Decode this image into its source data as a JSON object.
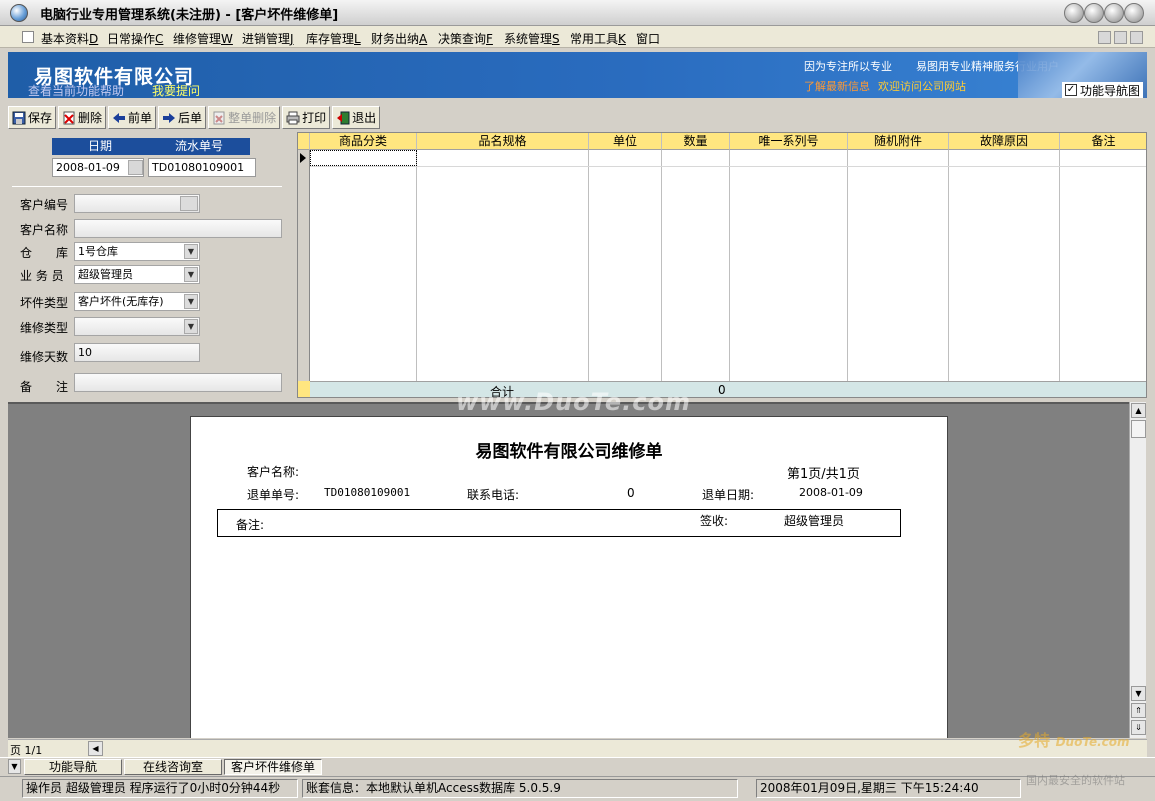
{
  "window": {
    "title": "电脑行业专用管理系统(未注册) - [客户坏件维修单]"
  },
  "menu": [
    {
      "label": "基本资料",
      "key": "D"
    },
    {
      "label": "日常操作",
      "key": "C"
    },
    {
      "label": "维修管理",
      "key": "W"
    },
    {
      "label": "进销管理",
      "key": "J"
    },
    {
      "label": "库存管理",
      "key": "L"
    },
    {
      "label": "财务出纳",
      "key": "A"
    },
    {
      "label": "决策查询",
      "key": "F"
    },
    {
      "label": "系统管理",
      "key": "S"
    },
    {
      "label": "常用工具",
      "key": "K"
    },
    {
      "label": "窗口",
      "key": ""
    }
  ],
  "banner": {
    "company": "易图软件有限公司",
    "help": "查看当前功能帮助",
    "ask": "我要提问",
    "slogan1": "因为专注所以专业",
    "slogan2": "易图用专业精神服务行业用户",
    "news": "了解最新信息",
    "visit": "欢迎访问公司网站",
    "nav_toggle": "功能导航图"
  },
  "toolbar": {
    "save": "保存",
    "delete": "删除",
    "prev": "前单",
    "next": "后单",
    "delete_all": "整单删除",
    "print": "打印",
    "exit": "退出"
  },
  "form": {
    "date_header": "日期",
    "serial_header": "流水单号",
    "date": "2008-01-09",
    "serial": "TD01080109001",
    "customer_code_label": "客户编号",
    "customer_code": "",
    "customer_name_label": "客户名称",
    "customer_name": "",
    "warehouse_label": "仓　　库",
    "warehouse": "1号仓库",
    "salesperson_label": "业 务 员",
    "salesperson": "超级管理员",
    "part_type_label": "坏件类型",
    "part_type": "客户坏件(无库存)",
    "repair_type_label": "维修类型",
    "repair_type": "",
    "repair_days_label": "维修天数",
    "repair_days": "10",
    "remark_label": "备　　注",
    "remark": ""
  },
  "grid": {
    "columns": [
      "商品分类",
      "品名规格",
      "单位",
      "数量",
      "唯一系列号",
      "随机附件",
      "故障原因",
      "备注"
    ],
    "total_label": "合计",
    "total_qty": "0"
  },
  "report": {
    "title": "易图软件有限公司维修单",
    "customer_label": "客户名称:",
    "page_info": "第1页/共1页",
    "order_label": "退单单号:",
    "order_no": "TD01080109001",
    "phone_label": "联系电话:",
    "phone": "0",
    "date_label": "退单日期:",
    "date": "2008-01-09",
    "remark_label": "备注:",
    "sign_label": "签收:",
    "signer": "超级管理员"
  },
  "watermark": "www.DuoTe.com",
  "page_indicator": "页 1/1",
  "tabs": [
    "功能导航",
    "在线咨询室",
    "客户坏件维修单"
  ],
  "status": {
    "operator": "操作员 超级管理员 程序运行了0小时0分钟44秒",
    "account": "账套信息：本地默认单机Access数据库 5.0.5.9",
    "datetime": "2008年01月09日,星期三  下午15:24:40"
  },
  "brand_watermark": {
    "name": "多特",
    "url": "DuoTe.com",
    "slogan": "国内最安全的软件站"
  },
  "colors": {
    "banner": "#2a6cbf",
    "grid_header": "#ffe680",
    "form_header": "#1c4e9c"
  }
}
